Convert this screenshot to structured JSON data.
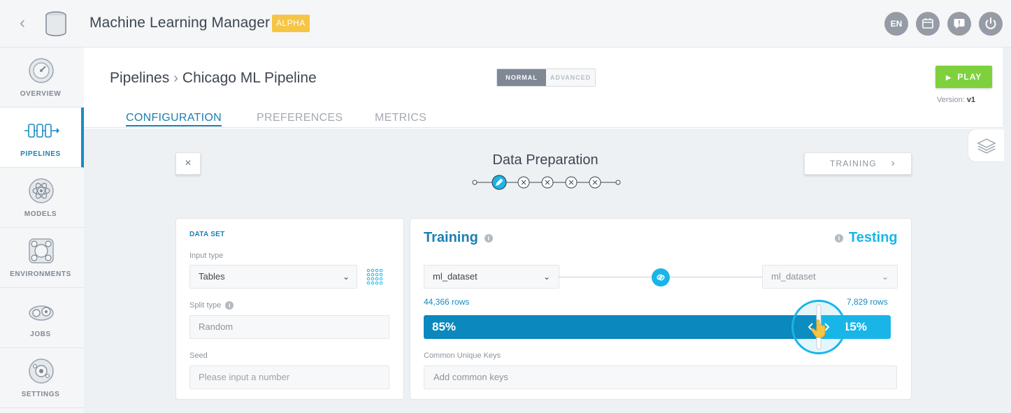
{
  "header": {
    "back_icon": "chevron-left-icon",
    "logo_icon": "database-icon",
    "title": "Machine Learning Manager",
    "badge": "ALPHA",
    "lang": "EN",
    "buttons": [
      "calendar-icon",
      "feedback-icon",
      "power-icon"
    ]
  },
  "sidebar": {
    "items": [
      {
        "label": "OVERVIEW",
        "icon": "dashboard-gauge-icon",
        "active": false
      },
      {
        "label": "PIPELINES",
        "icon": "pipeline-icon",
        "active": true
      },
      {
        "label": "MODELS",
        "icon": "atom-icon",
        "active": false
      },
      {
        "label": "ENVIRONMENTS",
        "icon": "environment-icon",
        "active": false
      },
      {
        "label": "JOBS",
        "icon": "gears-icon",
        "active": false
      },
      {
        "label": "SETTINGS",
        "icon": "settings-icon",
        "active": false
      }
    ]
  },
  "breadcrumb": {
    "root": "Pipelines",
    "current": "Chicago ML Pipeline"
  },
  "mode": {
    "normal": "NORMAL",
    "advanced": "ADVANCED",
    "selected": "NORMAL"
  },
  "play": {
    "label": "PLAY",
    "version_label": "Version:",
    "version_value": "v1"
  },
  "tabs": [
    {
      "label": "CONFIGURATION",
      "active": true
    },
    {
      "label": "PREFERENCES",
      "active": false
    },
    {
      "label": "METRICS",
      "active": false
    }
  ],
  "wizard": {
    "title": "Data Preparation",
    "current_step": 1,
    "total_steps": 5,
    "close_label": "×",
    "next_label": "TRAINING"
  },
  "dataset": {
    "heading": "DATA SET",
    "input_type_label": "Input type",
    "input_type_value": "Tables",
    "split_type_label": "Split type",
    "split_type_value": "Random",
    "seed_label": "Seed",
    "seed_placeholder": "Please input a number"
  },
  "split": {
    "training_title": "Training",
    "testing_title": "Testing",
    "training_dataset": "ml_dataset",
    "testing_dataset": "ml_dataset",
    "training_rows": "44,366 rows",
    "testing_rows": "7,829 rows",
    "training_pct": "85%",
    "testing_pct": "15%",
    "training_fraction": 0.85,
    "common_keys_label": "Common Unique Keys",
    "common_keys_placeholder": "Add common keys"
  },
  "colors": {
    "accent": "#1b7fb3",
    "training": "#0b88bd",
    "testing": "#19b5e8",
    "play": "#7ed13c",
    "alpha": "#f6c544"
  }
}
